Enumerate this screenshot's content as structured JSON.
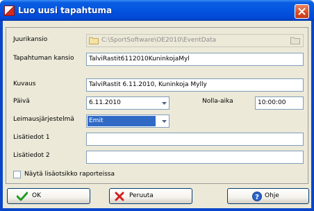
{
  "window": {
    "title": "Luo uusi tapahtuma"
  },
  "form": {
    "root_folder_label": "Juurikansio",
    "root_folder_value": "C:\\SportSoftware\\OE2010\\EventData",
    "event_folder_label": "Tapahtuman kansio",
    "event_folder_value": "TalviRastit6112010KuninkojaMyl",
    "description_label": "Kuvaus",
    "description_value": "TalviRastit 6.11.2010, Kuninkoja Mylly",
    "date_label": "Päivä",
    "date_value": "6.11.2010",
    "zero_time_label": "Nolla-aika",
    "zero_time_value": "10:00:00",
    "punching_system_label": "Leimausjärjestelmä",
    "punching_system_value": "Emit",
    "extra1_label": "Lisätiedot 1",
    "extra1_value": "",
    "extra2_label": "Lisätiedot 2",
    "extra2_value": "",
    "show_extra_header_label": "Näytä lisäotsikko raporteissa",
    "show_extra_header_checked": false
  },
  "buttons": {
    "ok_label": "OK",
    "cancel_label": "Peruuta",
    "help_label": "Ohje"
  },
  "icons": {
    "app": "orienteering-flag-icon",
    "close": "close-icon",
    "folder": "folder-icon",
    "ok": "checkmark-icon",
    "cancel": "red-x-icon",
    "help": "help-icon"
  },
  "colors": {
    "title_bar": "#0454e0",
    "close_button": "#d94a22",
    "dialog_background": "#ece9d8",
    "selection": "#316ac5"
  }
}
